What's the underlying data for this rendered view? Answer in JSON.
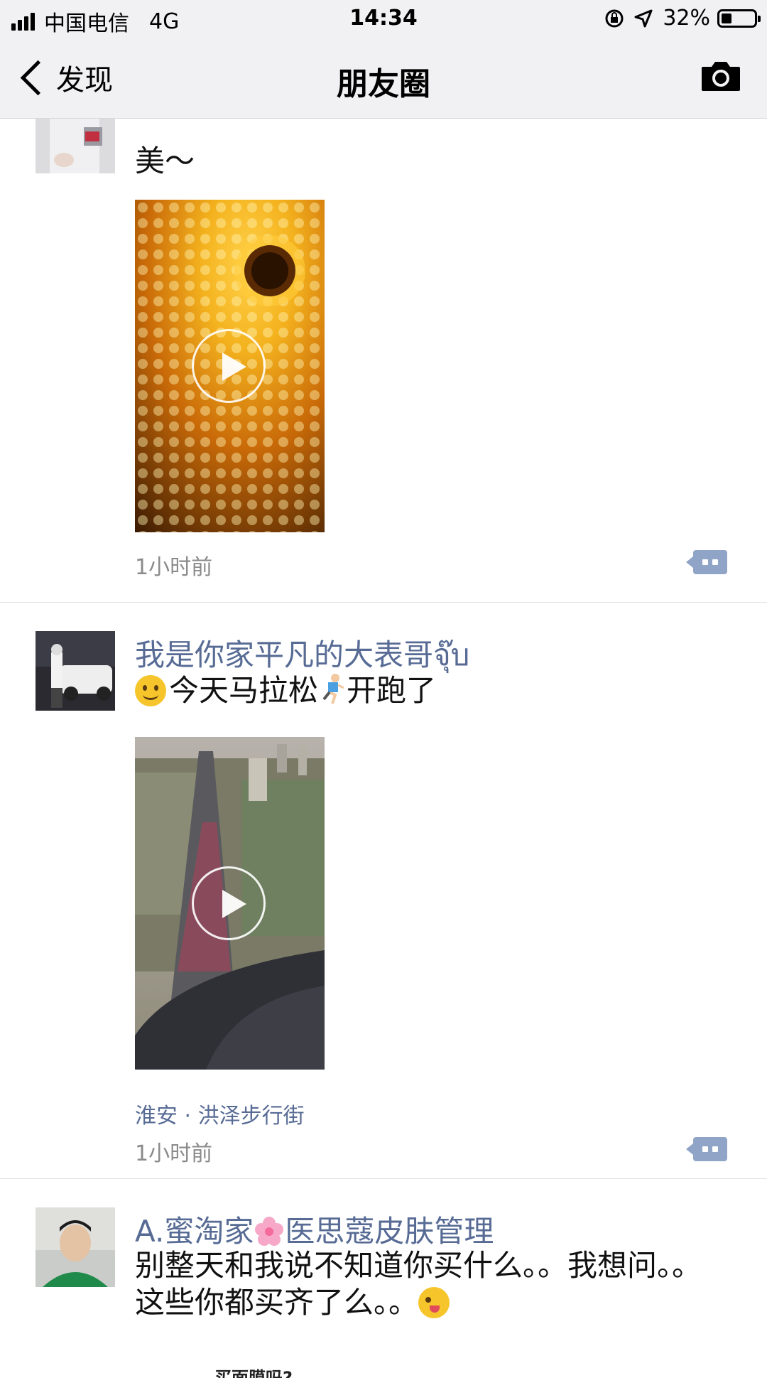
{
  "status_bar": {
    "carrier": "中国电信",
    "network": "4G",
    "time": "14:34",
    "battery": "32%",
    "battery_level": 0.32
  },
  "nav": {
    "back_label": "发现",
    "title": "朋友圈",
    "camera_icon": "camera-icon"
  },
  "posts": [
    {
      "text": "美～",
      "time": "1小时前",
      "video_colors": [
        "#3a1a02",
        "#c96a08",
        "#f4b21e"
      ]
    },
    {
      "author": "我是你家平凡的大表哥จุ๊บ",
      "text_a": "今天马拉松",
      "text_b": "开跑了",
      "location": "淮安 · 洪泽步行街",
      "time": "1小时前"
    },
    {
      "author_a": "A.蜜淘家",
      "author_b": "医思蔻皮肤管理",
      "text": "别整天和我说不知道你买什么。。我想问。。这些你都买齐了么。。",
      "peek_text": "买面膜吗?"
    }
  ],
  "colors": {
    "link_blue": "#576b95",
    "meta_gray": "#8a8a8a",
    "bar_bg": "#f1f1f3",
    "comment_btn": "#8fa4c7"
  }
}
